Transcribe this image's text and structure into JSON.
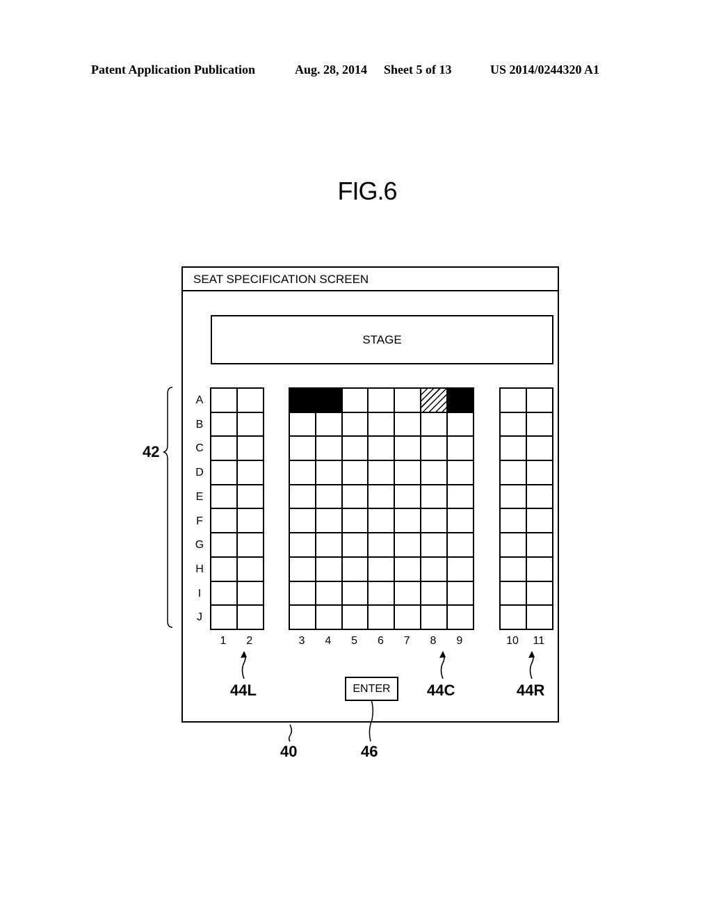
{
  "header": {
    "publication": "Patent Application Publication",
    "date": "Aug. 28, 2014",
    "sheet": "Sheet 5 of 13",
    "number": "US 2014/0244320 A1"
  },
  "figure": {
    "title": "FIG.6"
  },
  "screen": {
    "title": "SEAT SPECIFICATION SCREEN",
    "stage_label": "STAGE",
    "enter_label": "ENTER",
    "row_labels": [
      "A",
      "B",
      "C",
      "D",
      "E",
      "F",
      "G",
      "H",
      "I",
      "J"
    ],
    "blocks": [
      {
        "id": "left",
        "columns": [
          "1",
          "2"
        ]
      },
      {
        "id": "center",
        "columns": [
          "3",
          "4",
          "5",
          "6",
          "7",
          "8",
          "9"
        ]
      },
      {
        "id": "right",
        "columns": [
          "10",
          "11"
        ]
      }
    ],
    "seat_states": {
      "occupied": [
        "A3",
        "A4",
        "A9"
      ],
      "selected": [
        "A8"
      ]
    }
  },
  "reference_numerals": {
    "seat_rows": "42",
    "block_left": "44L",
    "block_center": "44C",
    "block_right": "44R",
    "screen": "40",
    "enter_button": "46"
  }
}
